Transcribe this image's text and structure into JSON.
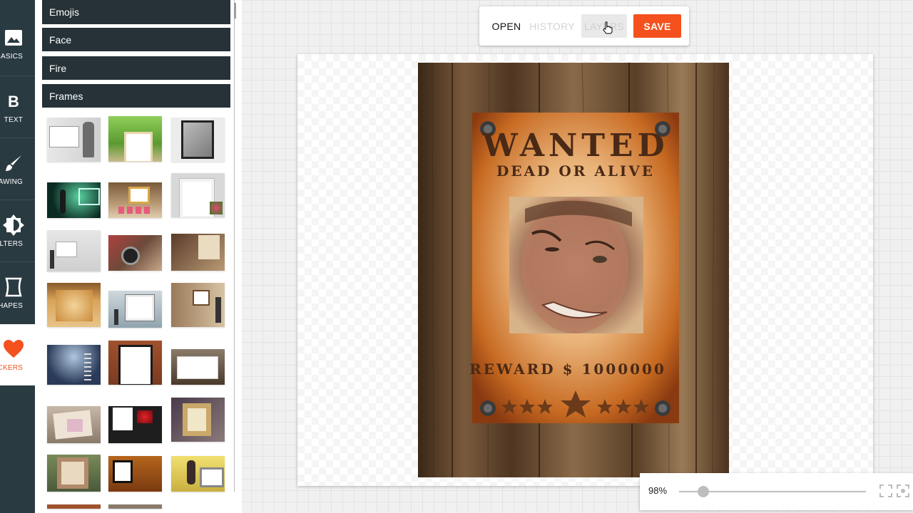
{
  "rail": {
    "items": [
      {
        "label": "BASICS",
        "icon": "image-icon"
      },
      {
        "label": "TEXT",
        "icon": "bold-b-icon"
      },
      {
        "label": "DRAWING",
        "icon": "brush-icon"
      },
      {
        "label": "FILTERS",
        "icon": "brightness-icon"
      },
      {
        "label": "SHAPES",
        "icon": "shape-icon"
      },
      {
        "label": "STICKERS",
        "icon": "heart-icon"
      }
    ],
    "active": "STICKERS",
    "accent_color": "#f4511e",
    "background_color": "#2a3a41"
  },
  "panel": {
    "categories": [
      {
        "label": "Emojis"
      },
      {
        "label": "Face"
      },
      {
        "label": "Fire"
      },
      {
        "label": "Frames"
      }
    ],
    "category_color": "#263238",
    "frame_thumbnails": [
      {
        "name": "frame-woman-board"
      },
      {
        "name": "frame-green-park"
      },
      {
        "name": "frame-grey-wall"
      },
      {
        "name": "frame-dark-window"
      },
      {
        "name": "frame-hearts-shelf"
      },
      {
        "name": "frame-white-flowers"
      },
      {
        "name": "frame-gallery"
      },
      {
        "name": "frame-watch-hand"
      },
      {
        "name": "frame-wanted-small"
      },
      {
        "name": "frame-wanted-poster"
      },
      {
        "name": "frame-street-billboard"
      },
      {
        "name": "frame-stone-wall"
      },
      {
        "name": "frame-blue-room"
      },
      {
        "name": "frame-brick-wall"
      },
      {
        "name": "frame-tv-screen"
      },
      {
        "name": "frame-pink-paper"
      },
      {
        "name": "frame-roses"
      },
      {
        "name": "frame-gold-frame"
      },
      {
        "name": "frame-old-paper"
      },
      {
        "name": "frame-brown-room"
      },
      {
        "name": "frame-old-tv"
      }
    ]
  },
  "toolbar": {
    "open_label": "OPEN",
    "history_label": "HISTORY",
    "layers_label": "LAYERS",
    "save_label": "SAVE",
    "save_color": "#f4511e"
  },
  "poster": {
    "title": "WANTED",
    "subtitle": "DEAD OR ALIVE",
    "reward": "REWARD $ 1000000"
  },
  "zoom": {
    "label": "98%",
    "value_percent": 98,
    "slider_fraction": 0.13,
    "fit_icon": "fit-screen-icon",
    "fullscreen_icon": "focus-icon"
  }
}
